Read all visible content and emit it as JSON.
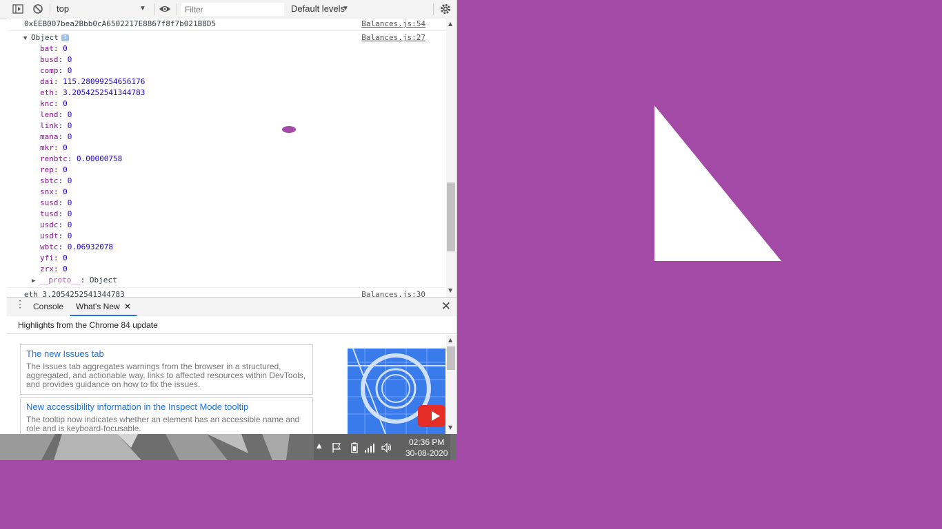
{
  "toolbar": {
    "context_value": "top",
    "filter_placeholder": "Filter",
    "levels_label": "Default levels"
  },
  "console": {
    "address_line": "0xEEB007bea2Bbb0cA6502217E8867f8f7b021B8D5",
    "address_source": "Balances.js:54",
    "object_label": "Object",
    "object_source": "Balances.js:27",
    "entries": [
      {
        "key": "bat",
        "value": "0"
      },
      {
        "key": "busd",
        "value": "0"
      },
      {
        "key": "comp",
        "value": "0"
      },
      {
        "key": "dai",
        "value": "115.28099254656176"
      },
      {
        "key": "eth",
        "value": "3.2054252541344783"
      },
      {
        "key": "knc",
        "value": "0"
      },
      {
        "key": "lend",
        "value": "0"
      },
      {
        "key": "link",
        "value": "0"
      },
      {
        "key": "mana",
        "value": "0"
      },
      {
        "key": "mkr",
        "value": "0"
      },
      {
        "key": "renbtc",
        "value": "0.00000758"
      },
      {
        "key": "rep",
        "value": "0"
      },
      {
        "key": "sbtc",
        "value": "0"
      },
      {
        "key": "snx",
        "value": "0"
      },
      {
        "key": "susd",
        "value": "0"
      },
      {
        "key": "tusd",
        "value": "0"
      },
      {
        "key": "usdc",
        "value": "0"
      },
      {
        "key": "usdt",
        "value": "0"
      },
      {
        "key": "wbtc",
        "value": "0.06932078"
      },
      {
        "key": "yfi",
        "value": "0"
      },
      {
        "key": "zrx",
        "value": "0"
      }
    ],
    "proto_key": "__proto__",
    "proto_value": "Object",
    "last_line": "eth 3.2054252541344783",
    "last_source": "Balances.js:30"
  },
  "drawer": {
    "tabs": [
      "Console",
      "What's New"
    ],
    "highlights": "Highlights from the Chrome 84 update",
    "cards": [
      {
        "title": "The new Issues tab",
        "desc": "The Issues tab aggregates warnings from the browser in a structured, aggregated, and actionable way, links to affected resources within DevTools, and provides guidance on how to fix the issues."
      },
      {
        "title": "New accessibility information in the Inspect Mode tooltip",
        "desc": "The tooltip now indicates whether an element has an accessible name and role and is keyboard-focusable."
      }
    ]
  },
  "taskbar": {
    "time": "02:36 PM",
    "date": "30-08-2020"
  },
  "colors": {
    "background": "#a24aa6",
    "accent": "#1a73e8",
    "object_key": "#881391",
    "number": "#1c00cf"
  }
}
